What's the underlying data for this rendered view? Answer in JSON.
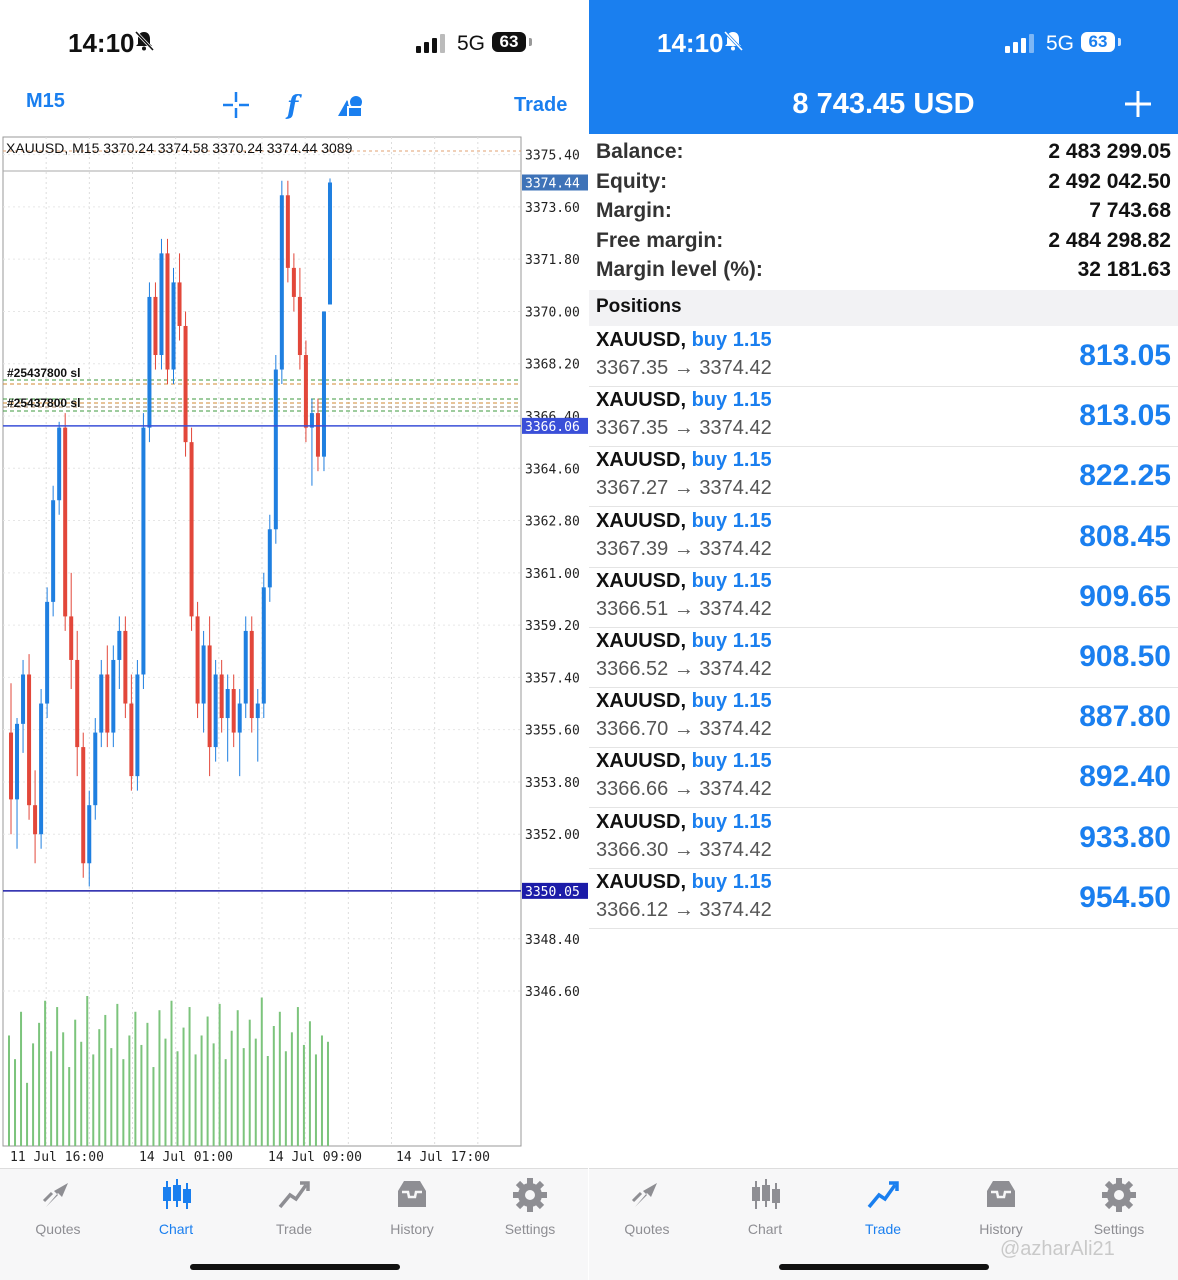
{
  "status": {
    "time": "14:10",
    "network": "5G",
    "battery": "63"
  },
  "chart_screen": {
    "timeframe": "M15",
    "trade_link": "Trade",
    "info_line": "XAUUSD, M15 3370.24 3374.58 3370.24 3374.44 3089",
    "order_line_tags": [
      "#25437800 sl",
      "#25437800 sl"
    ],
    "price_labels": [
      "3375.40",
      "3373.60",
      "3371.80",
      "3370.00",
      "3368.20",
      "3366.40",
      "3364.60",
      "3362.80",
      "3361.00",
      "3359.20",
      "3357.40",
      "3355.60",
      "3353.80",
      "3352.00",
      "3348.40",
      "3346.60"
    ],
    "current_price": "3374.44",
    "line_price_1": "3366.06",
    "line_price_2": "3350.05",
    "time_labels": [
      "11 Jul 16:00",
      "14 Jul 01:00",
      "14 Jul 09:00",
      "14 Jul 17:00"
    ]
  },
  "chart_data": {
    "type": "candlestick",
    "symbol": "XAUUSD",
    "timeframe": "M15",
    "ylim": [
      3345.5,
      3375.8
    ],
    "ohlc_last": {
      "open": 3370.24,
      "high": 3374.58,
      "low": 3370.24,
      "close": 3374.44,
      "volume": 3089
    },
    "horizontal_lines": [
      3366.06,
      3350.05
    ],
    "candles": [
      [
        3355.5,
        3357.2,
        3352.0,
        3353.2
      ],
      [
        3353.2,
        3356.0,
        3351.5,
        3355.8
      ],
      [
        3355.8,
        3358.0,
        3354.8,
        3357.5
      ],
      [
        3357.5,
        3358.2,
        3352.5,
        3353.0
      ],
      [
        3353.0,
        3354.2,
        3351.0,
        3352.0
      ],
      [
        3352.0,
        3357.0,
        3351.5,
        3356.5
      ],
      [
        3356.5,
        3360.5,
        3356.0,
        3360.0
      ],
      [
        3360.0,
        3364.0,
        3359.5,
        3363.5
      ],
      [
        3363.5,
        3366.2,
        3363.0,
        3366.0
      ],
      [
        3366.0,
        3366.5,
        3359.0,
        3359.5
      ],
      [
        3359.5,
        3361.0,
        3357.0,
        3358.0
      ],
      [
        3358.0,
        3359.0,
        3354.0,
        3355.0
      ],
      [
        3355.0,
        3355.5,
        3350.5,
        3351.0
      ],
      [
        3351.0,
        3353.5,
        3350.2,
        3353.0
      ],
      [
        3353.0,
        3356.0,
        3352.5,
        3355.5
      ],
      [
        3355.5,
        3358.0,
        3355.0,
        3357.5
      ],
      [
        3357.5,
        3358.5,
        3355.0,
        3355.5
      ],
      [
        3355.5,
        3358.5,
        3355.0,
        3358.0
      ],
      [
        3358.0,
        3359.5,
        3357.0,
        3359.0
      ],
      [
        3359.0,
        3359.5,
        3356.0,
        3356.5
      ],
      [
        3356.5,
        3357.5,
        3353.5,
        3354.0
      ],
      [
        3354.0,
        3358.0,
        3353.5,
        3357.5
      ],
      [
        3357.5,
        3366.5,
        3357.0,
        3366.0
      ],
      [
        3366.0,
        3371.0,
        3365.5,
        3370.5
      ],
      [
        3370.5,
        3371.0,
        3368.0,
        3368.5
      ],
      [
        3368.5,
        3372.5,
        3368.0,
        3372.0
      ],
      [
        3372.0,
        3372.5,
        3367.5,
        3368.0
      ],
      [
        3368.0,
        3371.5,
        3367.5,
        3371.0
      ],
      [
        3371.0,
        3372.0,
        3369.0,
        3369.5
      ],
      [
        3369.5,
        3370.0,
        3365.0,
        3365.5
      ],
      [
        3365.5,
        3366.0,
        3359.0,
        3359.5
      ],
      [
        3359.5,
        3360.0,
        3356.0,
        3356.5
      ],
      [
        3356.5,
        3359.0,
        3355.5,
        3358.5
      ],
      [
        3358.5,
        3359.5,
        3354.0,
        3355.0
      ],
      [
        3355.0,
        3358.0,
        3354.5,
        3357.5
      ],
      [
        3357.5,
        3358.0,
        3355.5,
        3356.0
      ],
      [
        3356.0,
        3357.5,
        3354.5,
        3357.0
      ],
      [
        3357.0,
        3357.5,
        3355.0,
        3355.5
      ],
      [
        3355.5,
        3357.0,
        3354.0,
        3356.5
      ],
      [
        3356.5,
        3359.5,
        3356.0,
        3359.0
      ],
      [
        3359.0,
        3359.5,
        3355.5,
        3356.0
      ],
      [
        3356.0,
        3357.0,
        3354.5,
        3356.5
      ],
      [
        3356.5,
        3361.0,
        3356.0,
        3360.5
      ],
      [
        3360.5,
        3363.0,
        3360.0,
        3362.5
      ],
      [
        3362.5,
        3368.5,
        3362.0,
        3368.0
      ],
      [
        3368.0,
        3374.5,
        3367.5,
        3374.0
      ],
      [
        3374.0,
        3374.5,
        3371.0,
        3371.5
      ],
      [
        3371.5,
        3372.0,
        3370.0,
        3370.5
      ],
      [
        3370.5,
        3371.5,
        3368.0,
        3368.5
      ],
      [
        3368.5,
        3369.0,
        3365.5,
        3366.0
      ],
      [
        3366.0,
        3367.0,
        3364.0,
        3366.5
      ],
      [
        3366.5,
        3367.0,
        3364.5,
        3365.0
      ],
      [
        3365.0,
        3370.0,
        3364.5,
        3370.0
      ],
      [
        3370.24,
        3374.58,
        3370.24,
        3374.44
      ]
    ],
    "volume": [
      70,
      55,
      85,
      40,
      65,
      78,
      92,
      60,
      88,
      72,
      50,
      80,
      66,
      95,
      58,
      74,
      83,
      62,
      90,
      55,
      70,
      85,
      64,
      78,
      50,
      86,
      68,
      92,
      60,
      75,
      88,
      58,
      70,
      82,
      65,
      90,
      55,
      73,
      86,
      62,
      80,
      68,
      94,
      57,
      76,
      85,
      60,
      72,
      88,
      64,
      79,
      58,
      70,
      66
    ]
  },
  "tabbar": {
    "tabs": [
      {
        "label": "Quotes",
        "icon": "quotes-icon"
      },
      {
        "label": "Chart",
        "icon": "chart-icon"
      },
      {
        "label": "Trade",
        "icon": "trade-icon"
      },
      {
        "label": "History",
        "icon": "history-icon"
      },
      {
        "label": "Settings",
        "icon": "settings-icon"
      }
    ],
    "left_active": "Chart",
    "right_active": "Trade"
  },
  "trade_screen": {
    "equity_title": "8 743.45 USD",
    "summary": [
      {
        "key": "Balance:",
        "value": "2 483 299.05"
      },
      {
        "key": "Equity:",
        "value": "2 492 042.50"
      },
      {
        "key": "Margin:",
        "value": "7 743.68"
      },
      {
        "key": "Free margin:",
        "value": "2 484 298.82"
      },
      {
        "key": "Margin level (%):",
        "value": "32 181.63"
      }
    ],
    "positions_header": "Positions",
    "positions": [
      {
        "symbol": "XAUUSD,",
        "side": "buy 1.15",
        "prices": "3367.35 → 3374.42",
        "profit": "813.05"
      },
      {
        "symbol": "XAUUSD,",
        "side": "buy 1.15",
        "prices": "3367.35 → 3374.42",
        "profit": "813.05"
      },
      {
        "symbol": "XAUUSD,",
        "side": "buy 1.15",
        "prices": "3367.27 → 3374.42",
        "profit": "822.25"
      },
      {
        "symbol": "XAUUSD,",
        "side": "buy 1.15",
        "prices": "3367.39 → 3374.42",
        "profit": "808.45"
      },
      {
        "symbol": "XAUUSD,",
        "side": "buy 1.15",
        "prices": "3366.51 → 3374.42",
        "profit": "909.65"
      },
      {
        "symbol": "XAUUSD,",
        "side": "buy 1.15",
        "prices": "3366.52 → 3374.42",
        "profit": "908.50"
      },
      {
        "symbol": "XAUUSD,",
        "side": "buy 1.15",
        "prices": "3366.70 → 3374.42",
        "profit": "887.80"
      },
      {
        "symbol": "XAUUSD,",
        "side": "buy 1.15",
        "prices": "3366.66 → 3374.42",
        "profit": "892.40"
      },
      {
        "symbol": "XAUUSD,",
        "side": "buy 1.15",
        "prices": "3366.30 → 3374.42",
        "profit": "933.80"
      },
      {
        "symbol": "XAUUSD,",
        "side": "buy 1.15",
        "prices": "3366.12 → 3374.42",
        "profit": "954.50"
      }
    ]
  },
  "watermark": "@azharAli21",
  "colors": {
    "accent": "#1a7fef",
    "bull": "#1f7fe0",
    "bear": "#e2473a",
    "volume": "#7cc47c"
  }
}
